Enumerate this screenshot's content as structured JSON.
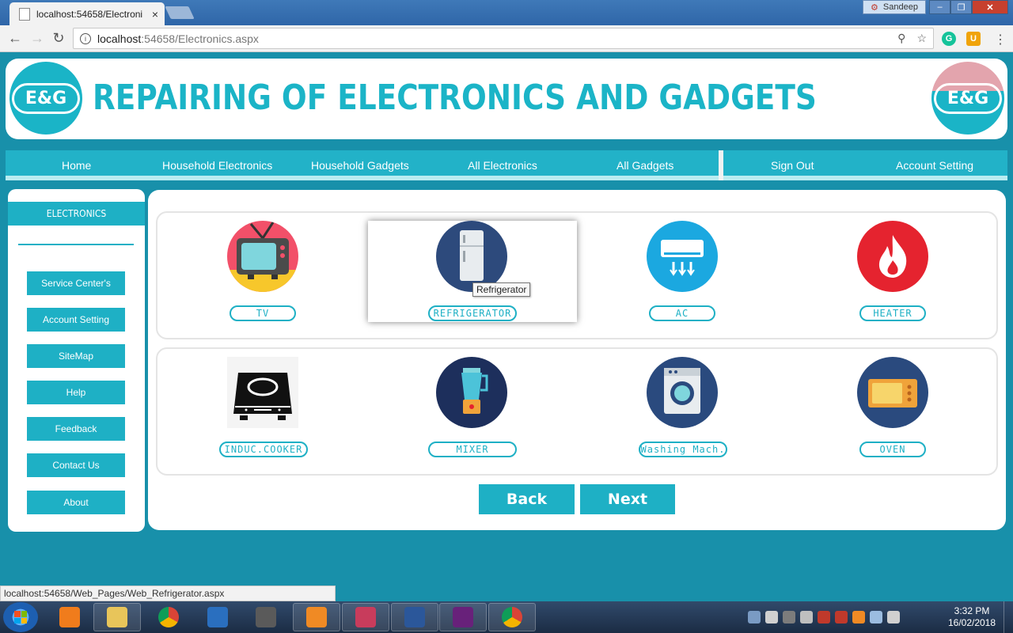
{
  "browser": {
    "tab_title": "localhost:54658/Electroni",
    "tab_close": "×",
    "user_name": "Sandeep",
    "url_host": "localhost",
    "url_path": ":54658/Electronics.aspx",
    "status_url": "localhost:54658/Web_Pages/Web_Refrigerator.aspx"
  },
  "header": {
    "title": "REPAIRING OF  ELECTRONICS AND GADGETS",
    "logo_text": "E&G"
  },
  "nav": {
    "home": "Home",
    "household_electronics": "Household Electronics",
    "household_gadgets": "Household Gadgets",
    "all_electronics": "All Electronics",
    "all_gadgets": "All Gadgets",
    "sign_out": "Sign Out",
    "account_setting": "Account Setting"
  },
  "sidebar": {
    "heading": "ELECTRONICS",
    "items": [
      {
        "label": "Service Center's"
      },
      {
        "label": "Account Setting"
      },
      {
        "label": "SiteMap"
      },
      {
        "label": "Help"
      },
      {
        "label": "Feedback"
      },
      {
        "label": "Contact Us"
      },
      {
        "label": "About"
      }
    ]
  },
  "products": [
    {
      "label": "TV",
      "icon": "tv-icon"
    },
    {
      "label": "REFRIGERATOR",
      "icon": "refrigerator-icon"
    },
    {
      "label": "AC",
      "icon": "ac-icon"
    },
    {
      "label": "HEATER",
      "icon": "heater-icon"
    },
    {
      "label": "INDUC.COOKER",
      "icon": "induction-cooker-icon"
    },
    {
      "label": "MIXER",
      "icon": "mixer-icon"
    },
    {
      "label": "Washing Mach.",
      "icon": "washing-machine-icon"
    },
    {
      "label": "OVEN",
      "icon": "oven-icon"
    }
  ],
  "tooltip": "Refrigerator",
  "buttons": {
    "back": "Back",
    "next": "Next"
  },
  "clock": {
    "time": "3:32 PM",
    "date": "16/02/2018"
  },
  "colors": {
    "accent": "#1eb0c5",
    "page_bg": "#1890aa"
  }
}
